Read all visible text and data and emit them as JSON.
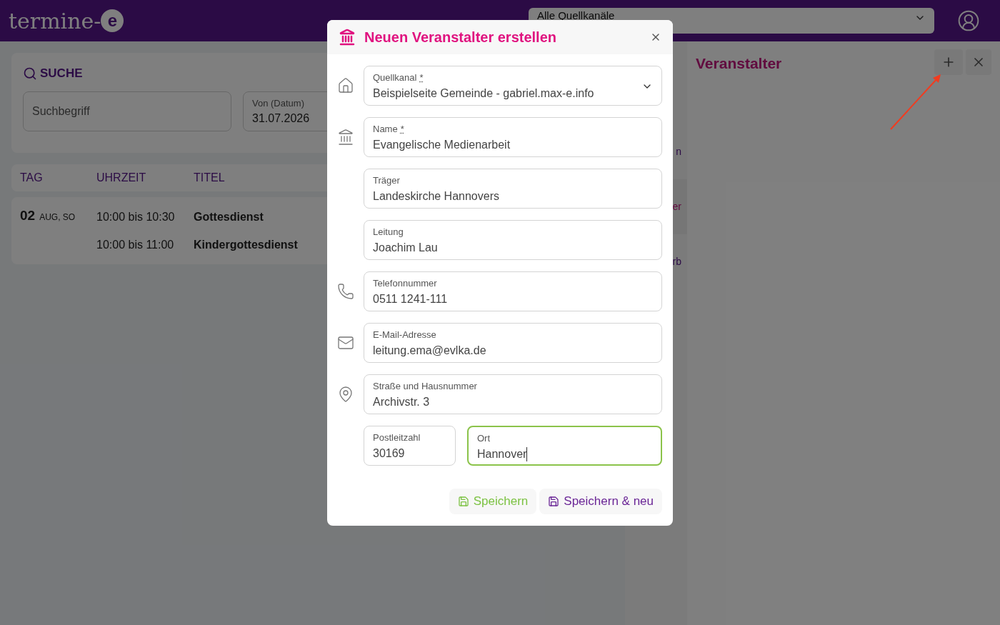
{
  "header": {
    "logo_text": "termine-",
    "logo_badge": "e",
    "channel_select": "Alle Quellkanäle"
  },
  "search": {
    "title": "SUCHE",
    "term_field": {
      "placeholder": "Suchbegriff"
    },
    "date_field": {
      "label": "Von (Datum)",
      "value": "31.07.2026"
    }
  },
  "table": {
    "columns": [
      "TAG",
      "UHRZEIT",
      "TITEL"
    ],
    "days": [
      {
        "day": "02",
        "weekday": "AUG, SO",
        "events": [
          {
            "time": "10:00 bis 10:30",
            "title": "Gottesdienst"
          },
          {
            "time": "10:00 bis 11:00",
            "title": "Kindergottesdienst"
          }
        ]
      }
    ]
  },
  "side_menu": [
    {
      "label": "n",
      "selected": false
    },
    {
      "label": "er",
      "selected": true
    },
    {
      "label": "rb",
      "selected": false
    }
  ],
  "side_panel": {
    "title": "Veranstalter"
  },
  "dialog": {
    "title": "Neuen Veranstalter erstellen",
    "fields": [
      {
        "kind": "select",
        "label": "Quellkanal",
        "required_mark": "*",
        "value": "Beispielseite Gemeinde - gabriel.max-e.info"
      },
      {
        "kind": "text",
        "label": "Name",
        "required_mark": "*",
        "value": "Evangelische Medienarbeit"
      },
      {
        "kind": "text",
        "label": "Träger",
        "value": "Landeskirche Hannovers"
      },
      {
        "kind": "text",
        "label": "Leitung",
        "value": "Joachim Lau"
      },
      {
        "kind": "text",
        "label": "Telefonnummer",
        "value": "0511 1241-111"
      },
      {
        "kind": "text",
        "label": "E-Mail-Adresse",
        "value": "leitung.ema@evlka.de"
      },
      {
        "kind": "text",
        "label": "Straße und Hausnummer",
        "value": "Archivstr. 3"
      },
      {
        "kind": "row",
        "fields": [
          {
            "label": "Postleitzahl",
            "value": "30169",
            "focused": false
          },
          {
            "label": "Ort",
            "value": "Hannover",
            "focused": true
          }
        ]
      }
    ],
    "buttons": [
      {
        "kind": "save",
        "label": "Speichern"
      },
      {
        "kind": "save_new",
        "label": "Speichern & neu"
      }
    ]
  }
}
